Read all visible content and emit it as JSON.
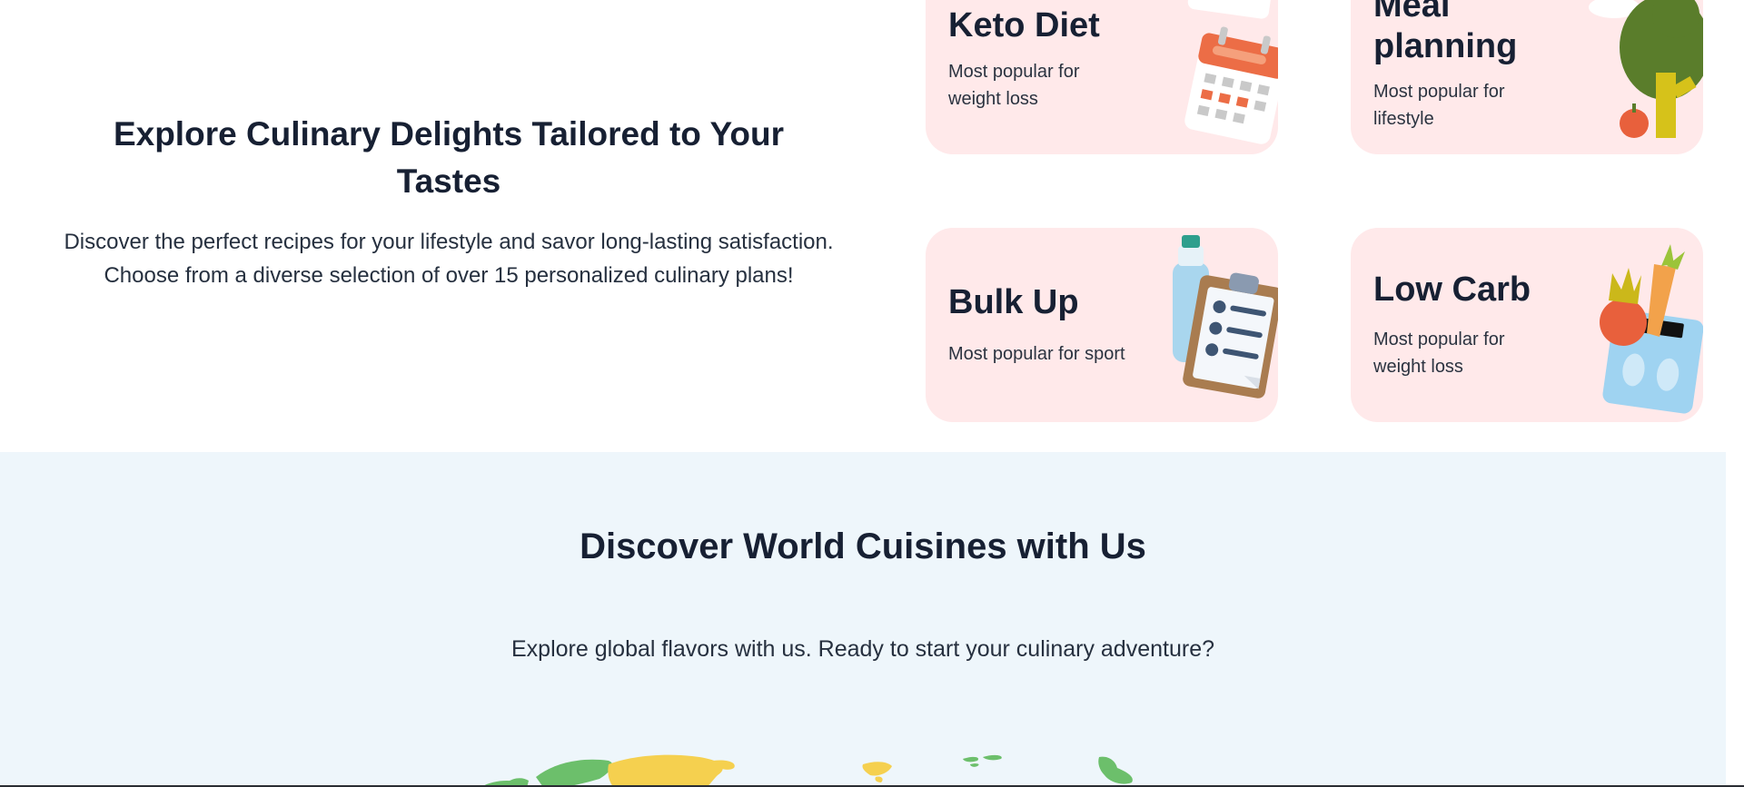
{
  "intro": {
    "title": "Explore Culinary Delights Tailored to Your Tastes",
    "description": "Discover the perfect recipes for your lifestyle and savor long-lasting satisfaction. Choose from a diverse selection of over 15 personalized culinary plans!"
  },
  "plans": {
    "keto": {
      "title": "Keto Diet",
      "description": "Most popular for weight loss",
      "icon": "calendar-icon"
    },
    "meal_planning": {
      "title": "Meal planning",
      "description": "Most popular for lifestyle",
      "icon": "tree-icon"
    },
    "bulk_up": {
      "title": "Bulk Up",
      "description": "Most popular for sport",
      "icon": "clipboard-icon"
    },
    "low_carb": {
      "title": "Low Carb",
      "description": "Most popular for weight loss",
      "icon": "scale-vegetables-icon"
    }
  },
  "world": {
    "title": "Discover World Cuisines with Us",
    "subtitle": "Explore global flavors with us. Ready to start your culinary adventure?"
  },
  "colors": {
    "card_background": "#ffe9ea",
    "world_background": "#eef6fb",
    "heading_text": "#172033",
    "map_green": "#6cbf6b",
    "map_yellow": "#f5d04f"
  }
}
